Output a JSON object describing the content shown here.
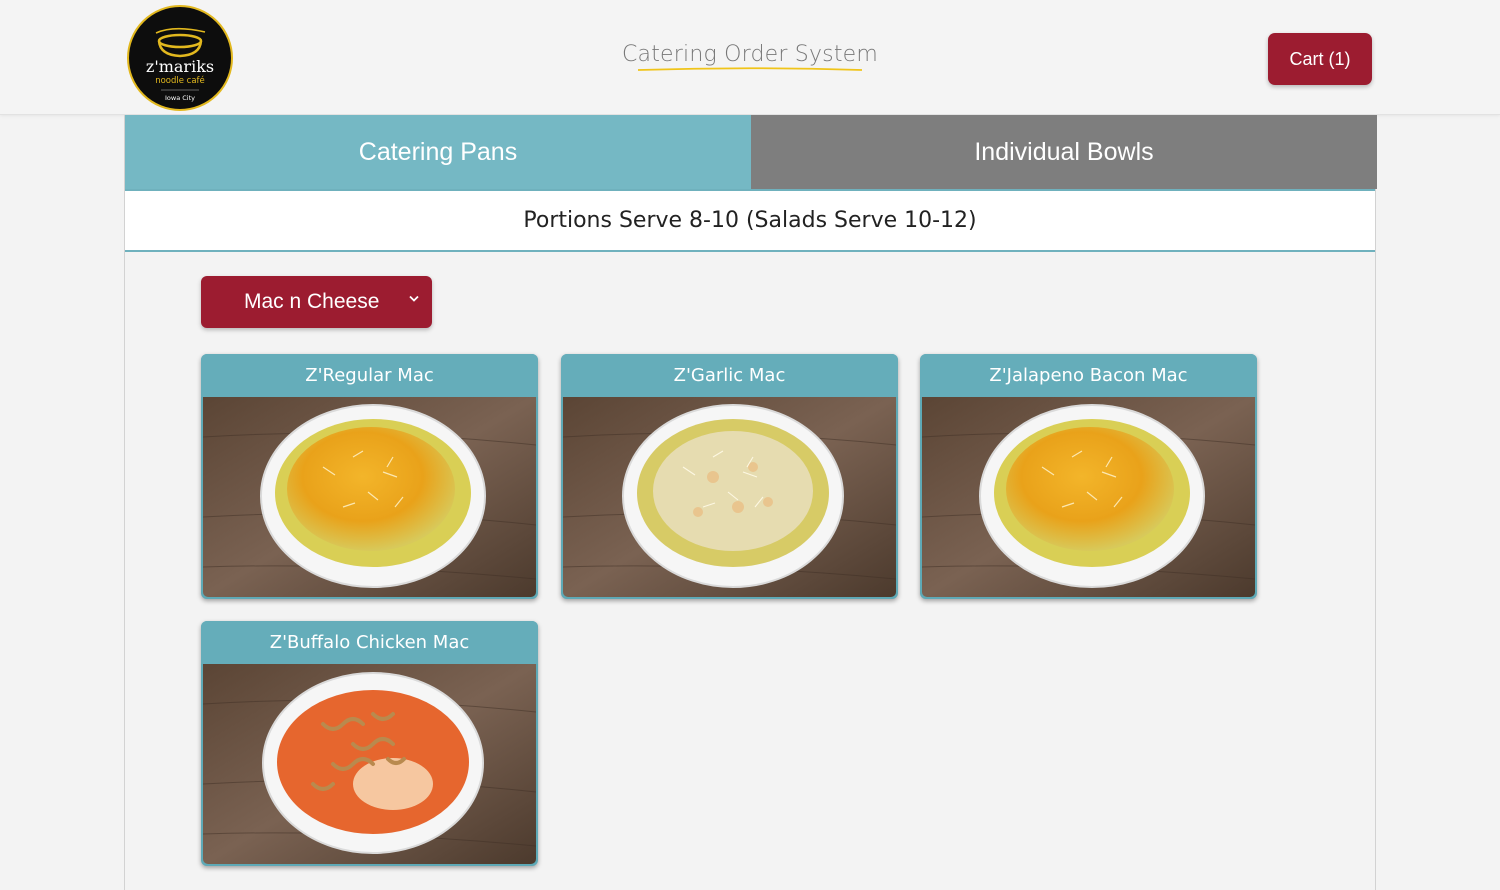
{
  "header": {
    "logo": {
      "brand": "z'mariks",
      "tagline": "noodle café",
      "location": "Iowa City"
    },
    "title": "Catering Order System",
    "cart_label": "Cart (1)"
  },
  "tabs": [
    {
      "label": "Catering Pans",
      "active": true
    },
    {
      "label": "Individual Bowls",
      "active": false
    }
  ],
  "portion_note": "Portions Serve 8-10 (Salads Serve 10-12)",
  "category_select": {
    "selected": "Mac n Cheese"
  },
  "menu_items": [
    {
      "name": "Z'Regular Mac",
      "topping": "cheddar"
    },
    {
      "name": "Z'Garlic Mac",
      "topping": "parmesan"
    },
    {
      "name": "Z'Jalapeno Bacon Mac",
      "topping": "cheddar"
    },
    {
      "name": "Z'Buffalo Chicken Mac",
      "topping": "crispy-onion"
    }
  ],
  "colors": {
    "brand_red": "#9c1c30",
    "teal": "#65adba",
    "tab_active": "#75b8c4",
    "tab_inactive": "#7e7e7e",
    "logo_gold": "#e2b81e"
  }
}
